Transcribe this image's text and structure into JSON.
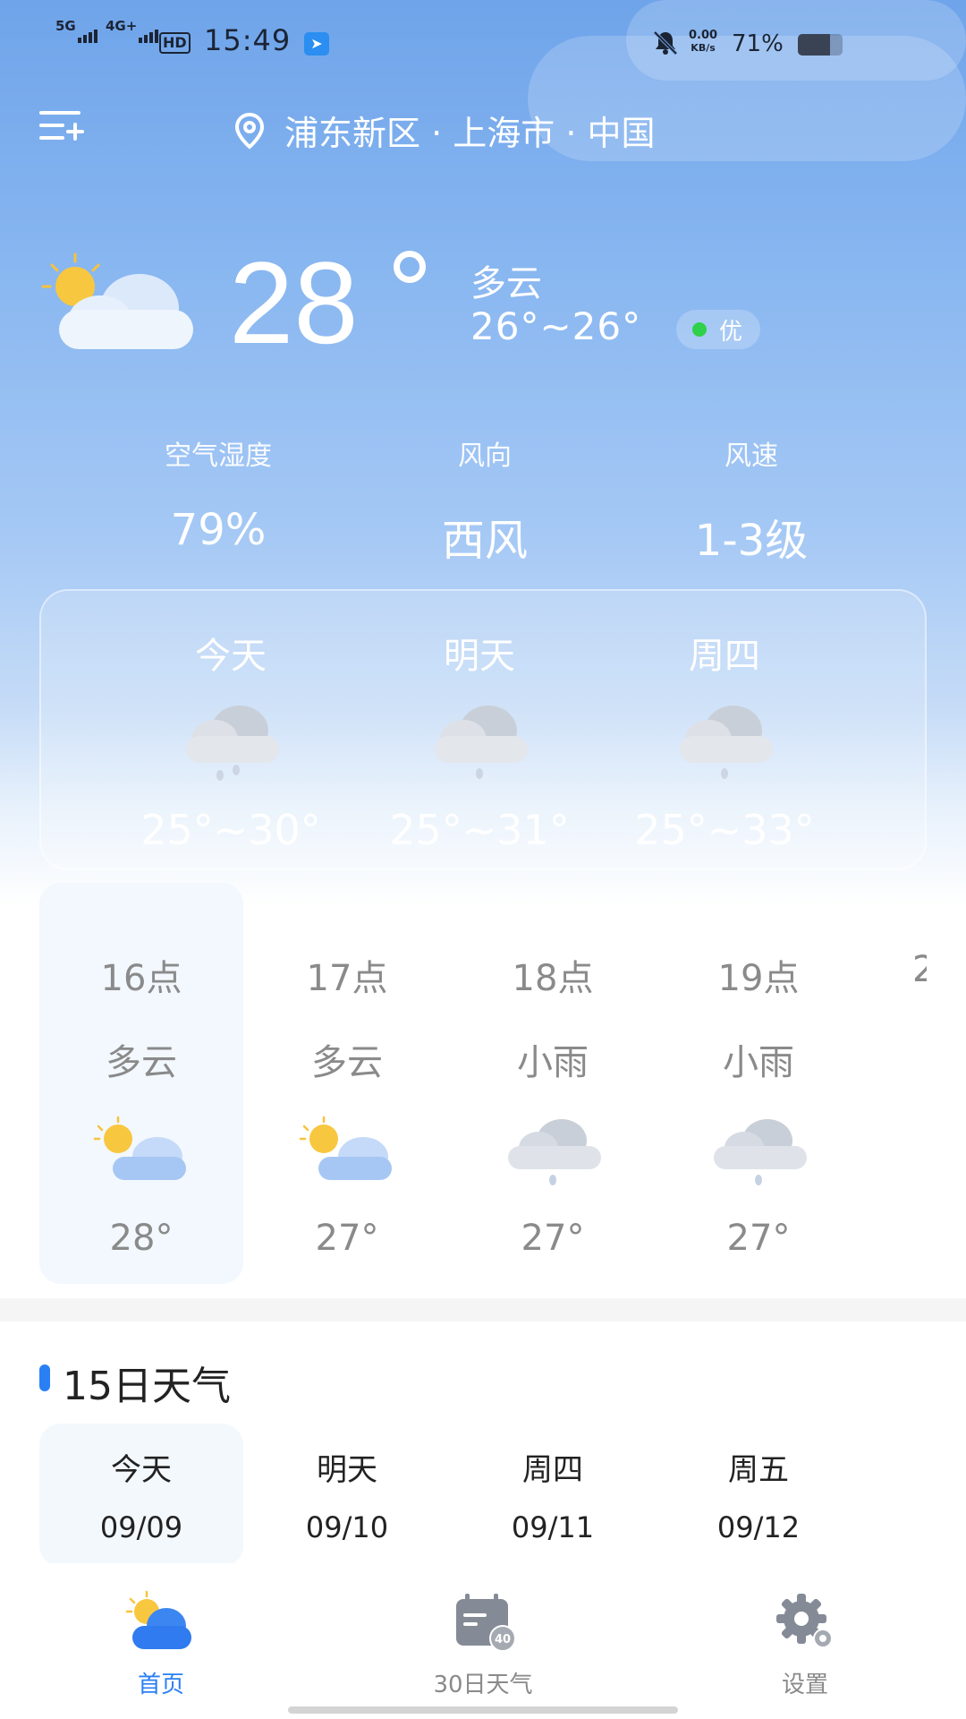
{
  "status_bar": {
    "network1": "5G",
    "network2": "4G+",
    "hd": "HD",
    "time": "15:49",
    "net_speed_value": "0.00",
    "net_speed_unit": "KB/s",
    "battery_percent": "71%",
    "battery_level": 0.71
  },
  "header": {
    "menu_icon": "menu-add-icon",
    "location": "浦东新区 · 上海市 · 中国"
  },
  "current": {
    "icon": "partly-cloudy-icon",
    "temperature": "28",
    "condition": "多云",
    "range": "26°~26°",
    "aqi_label": "优",
    "aqi_color": "#2ed149"
  },
  "stats": [
    {
      "label": "空气湿度",
      "value": "79%"
    },
    {
      "label": "风向",
      "value": "西风"
    },
    {
      "label": "风速",
      "value": "1-3级"
    }
  ],
  "three_day": [
    {
      "name": "今天",
      "icon": "light-rain-icon",
      "range": "25°~30°"
    },
    {
      "name": "明天",
      "icon": "light-rain-icon",
      "range": "25°~31°"
    },
    {
      "name": "周四",
      "icon": "light-rain-icon",
      "range": "25°~33°"
    }
  ],
  "hourly": [
    {
      "hour": "16点",
      "condition": "多云",
      "icon": "partly-cloudy-icon",
      "temp": "28°"
    },
    {
      "hour": "17点",
      "condition": "多云",
      "icon": "partly-cloudy-icon",
      "temp": "27°"
    },
    {
      "hour": "18点",
      "condition": "小雨",
      "icon": "light-rain-icon",
      "temp": "27°"
    },
    {
      "hour": "19点",
      "condition": "小雨",
      "icon": "light-rain-icon",
      "temp": "27°"
    }
  ],
  "fifteen_day": {
    "title": "15日天气",
    "days": [
      {
        "name": "今天",
        "date": "09/09"
      },
      {
        "name": "明天",
        "date": "09/10"
      },
      {
        "name": "周四",
        "date": "09/11"
      },
      {
        "name": "周五",
        "date": "09/12"
      }
    ]
  },
  "bottom_nav": [
    {
      "label": "首页",
      "icon": "home-weather-icon",
      "active": true
    },
    {
      "label": "30日天气",
      "icon": "calendar-40-icon",
      "badge": "40",
      "active": false
    },
    {
      "label": "设置",
      "icon": "settings-gear-icon",
      "active": false
    }
  ],
  "colors": {
    "accent": "#2a7ff5",
    "sky_top": "#6fa4ea"
  }
}
